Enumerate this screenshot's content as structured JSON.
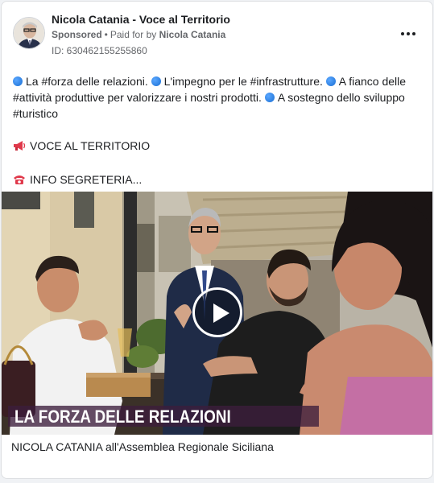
{
  "post": {
    "page_name": "Nicola Catania - Voce al Territorio",
    "sponsored_label": "Sponsored",
    "separator": "•",
    "paid_by_prefix": "Paid for by",
    "paid_by_name": "Nicola Catania",
    "ad_id": "ID: 630462155255860",
    "more_icon": "more-horizontal-icon"
  },
  "text": {
    "line1_items": [
      "La #forza delle relazioni.",
      "L'impegno per le #infrastrutture.",
      "A fianco delle #attività produttive per valorizzare i nostri prodotti.",
      "A sostegno dello sviluppo #turistico"
    ],
    "megaphone_icon": "megaphone-icon",
    "voice_line": "VOCE AL TERRITORIO",
    "phone_icon": "telephone-icon",
    "info_line": "INFO SEGRETERIA..."
  },
  "media": {
    "overlay_text": "LA FORZA DELLE RELAZIONI",
    "play_icon": "play-icon",
    "overlay_color": "#3c1e3c"
  },
  "caption": "NICOLA CATANIA all'Assemblea Regionale Siciliana",
  "colors": {
    "accent_blue": "#1877f2",
    "text_primary": "#1c1e21",
    "text_secondary": "#65676b"
  }
}
